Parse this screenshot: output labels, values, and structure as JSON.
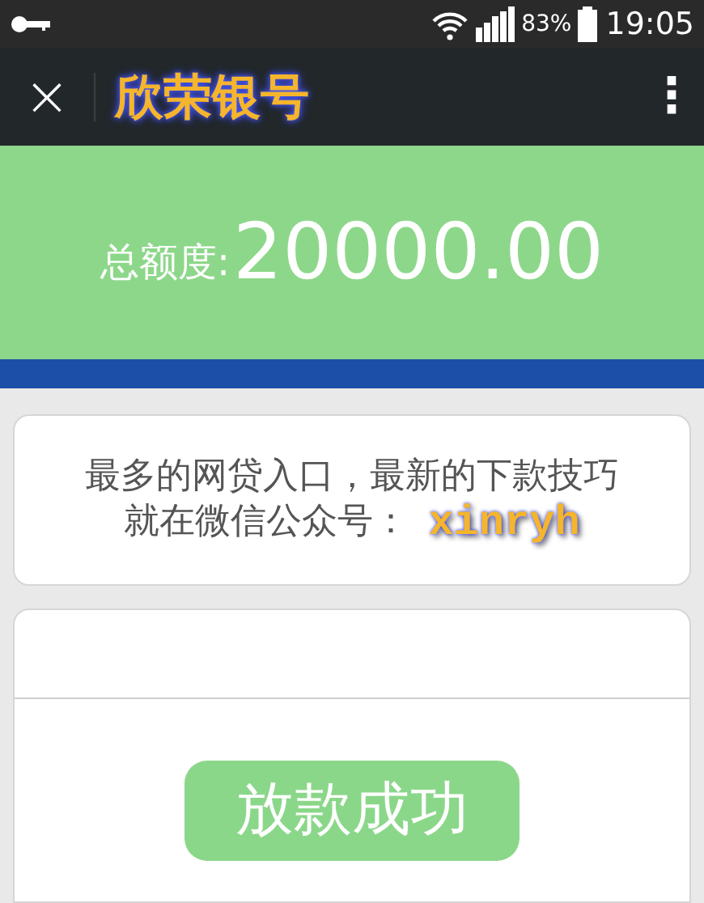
{
  "status_bar": {
    "battery": "83%",
    "time": "19:05"
  },
  "nav_bar": {
    "close": "×",
    "title": "欣荣银号",
    "menu": "⋮"
  },
  "limit": {
    "label": "总额度:",
    "amount": "20000.00"
  },
  "notice": {
    "line_1": "最多的网贷入口，最新的下款技巧",
    "line_2": "就在微信公众号：",
    "account": "xinryh"
  },
  "result": {
    "button": "放款成功"
  }
}
